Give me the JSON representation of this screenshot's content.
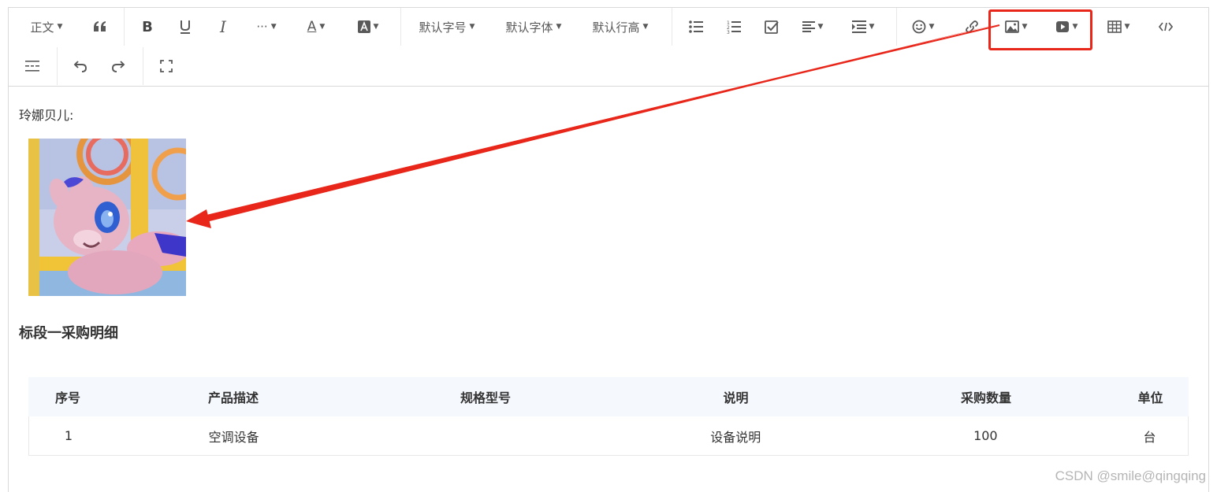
{
  "toolbar": {
    "paragraph_label": "正文",
    "font_size_label": "默认字号",
    "font_family_label": "默认字体",
    "line_height_label": "默认行高",
    "more_label": "···"
  },
  "content": {
    "greeting": "玲娜贝儿:",
    "section_title": "标段一采购明细",
    "table": {
      "headers": [
        "序号",
        "产品描述",
        "规格型号",
        "说明",
        "采购数量",
        "单位"
      ],
      "rows": [
        [
          "1",
          "空调设备",
          "",
          "设备说明",
          "100",
          "台"
        ]
      ]
    }
  },
  "watermark": "CSDN @smile@qingqing",
  "annotation": {
    "color": "#e8261a"
  }
}
